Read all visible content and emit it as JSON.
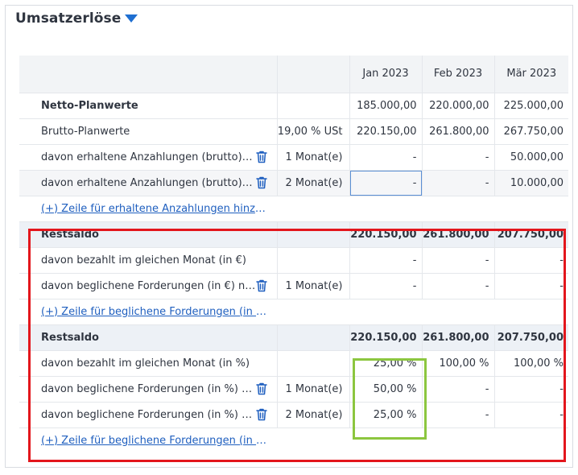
{
  "section": {
    "title": "Umsatzerlöse"
  },
  "columns": [
    "Jan 2023",
    "Feb 2023",
    "Mär 2023"
  ],
  "rows": [
    {
      "type": "bold",
      "label": "Netto-Planwerte",
      "param": "",
      "values": [
        "185.000,00",
        "220.000,00",
        "225.000,00"
      ],
      "trash": false
    },
    {
      "type": "normal",
      "label": "Brutto-Planwerte",
      "param": "19,00 % USt",
      "values": [
        "220.150,00",
        "261.800,00",
        "267.750,00"
      ],
      "trash": false
    },
    {
      "type": "normal",
      "label": "davon erhaltene Anzahlungen (brutto) (in €)",
      "param": "1 Monat(e)",
      "values": [
        "-",
        "-",
        "50.000,00"
      ],
      "trash": true
    },
    {
      "type": "alt",
      "label": "davon erhaltene Anzahlungen (brutto) (in €)",
      "param": "2 Monat(e)",
      "values": [
        "-",
        "-",
        "10.000,00"
      ],
      "trash": true,
      "selected_col": 0
    },
    {
      "type": "link",
      "label": "(+) Zeile für erhaltene Anzahlungen hinzufügen"
    },
    {
      "type": "section",
      "label": "Restsaldo",
      "param": "",
      "values": [
        "220.150,00",
        "261.800,00",
        "207.750,00"
      ],
      "trash": false
    },
    {
      "type": "normal",
      "label": "davon bezahlt im gleichen Monat (in €)",
      "param": "",
      "values": [
        "-",
        "-",
        "-"
      ],
      "trash": false
    },
    {
      "type": "normal",
      "label": "davon beglichene Forderungen (in €) nach",
      "param": "1 Monat(e)",
      "values": [
        "-",
        "-",
        "-"
      ],
      "trash": true
    },
    {
      "type": "link",
      "label": "(+) Zeile für beglichene Forderungen (in €) hinzufügen"
    },
    {
      "type": "section",
      "label": "Restsaldo",
      "param": "",
      "values": [
        "220.150,00",
        "261.800,00",
        "207.750,00"
      ],
      "trash": false
    },
    {
      "type": "normal",
      "label": "davon bezahlt im gleichen Monat (in %)",
      "param": "",
      "values": [
        "25,00 %",
        "100,00 %",
        "100,00 %"
      ],
      "trash": false
    },
    {
      "type": "normal",
      "label": "davon beglichene Forderungen (in %) nach",
      "param": "1 Monat(e)",
      "values": [
        "50,00 %",
        "-",
        "-"
      ],
      "trash": true
    },
    {
      "type": "normal",
      "label": "davon beglichene Forderungen (in %) nach",
      "param": "2 Monat(e)",
      "values": [
        "25,00 %",
        "-",
        "-"
      ],
      "trash": true
    },
    {
      "type": "link",
      "label": "(+) Zeile für beglichene Forderungen (in %) hinzufügen"
    }
  ],
  "highlight_colors": {
    "red_frame": "#e3161c",
    "green_frame": "#8cc63f",
    "accent": "#1f6fd1"
  }
}
